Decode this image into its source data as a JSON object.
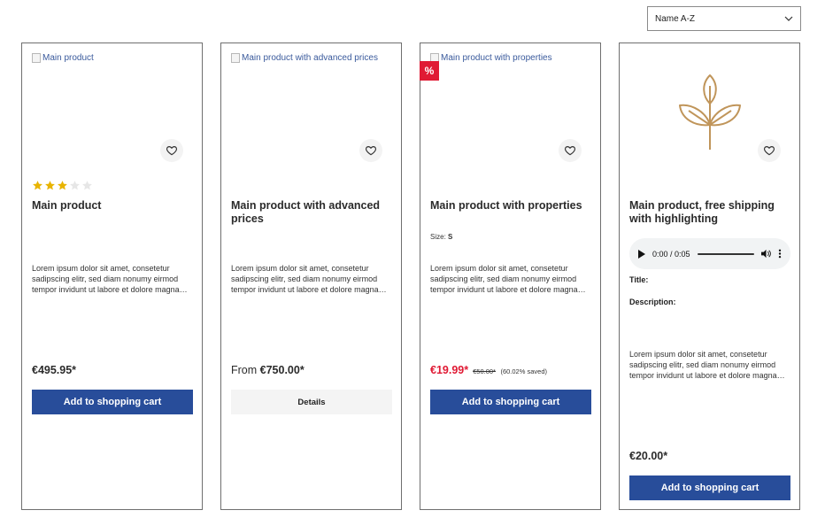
{
  "sort": {
    "selected": "Name A-Z"
  },
  "products": [
    {
      "image_alt": "Main product",
      "rating": 3,
      "title": "Main product",
      "description": "Lorem ipsum dolor sit amet, consetetur sadipscing elitr, sed diam nonumy eirmod tempor invidunt ut labore et dolore magna aliquyam erat, sed diam voluptua.",
      "price": "€495.95*",
      "button": "Add to shopping cart"
    },
    {
      "image_alt": "Main product with advanced prices",
      "title": "Main product with advanced prices",
      "description": "Lorem ipsum dolor sit amet, consetetur sadipscing elitr, sed diam nonumy eirmod tempor invidunt ut labore et dolore magna aliquyam erat, sed diam voluptua.",
      "price_prefix": "From",
      "price": "€750.00*",
      "button": "Details"
    },
    {
      "image_alt": "Main product with properties",
      "badge": "%",
      "title": "Main product with properties",
      "property_label": "Size:",
      "property_value": "S",
      "description": "Lorem ipsum dolor sit amet, consetetur sadipscing elitr, sed diam nonumy eirmod tempor invidunt ut labore et dolore magna aliquyam erat, sed diam voluptua.",
      "price": "€19.99*",
      "old_price": "€50.00*",
      "saved": "(60.02% saved)",
      "button": "Add to shopping cart"
    },
    {
      "title": "Main product, free shipping with highlighting",
      "audio_time": "0:00 / 0:05",
      "field_title": "Title:",
      "field_description": "Description:",
      "description": "Lorem ipsum dolor sit amet, consetetur sadipscing elitr, sed diam nonumy eirmod tempor invidunt ut labore et dolore magna aliquyam erat, sed diam voluptua.",
      "price": "€20.00*",
      "button": "Add to shopping cart"
    }
  ],
  "colors": {
    "primary": "#284d9a",
    "sale": "#e01a34",
    "star": "#e8b400",
    "plant": "#c0955a"
  }
}
